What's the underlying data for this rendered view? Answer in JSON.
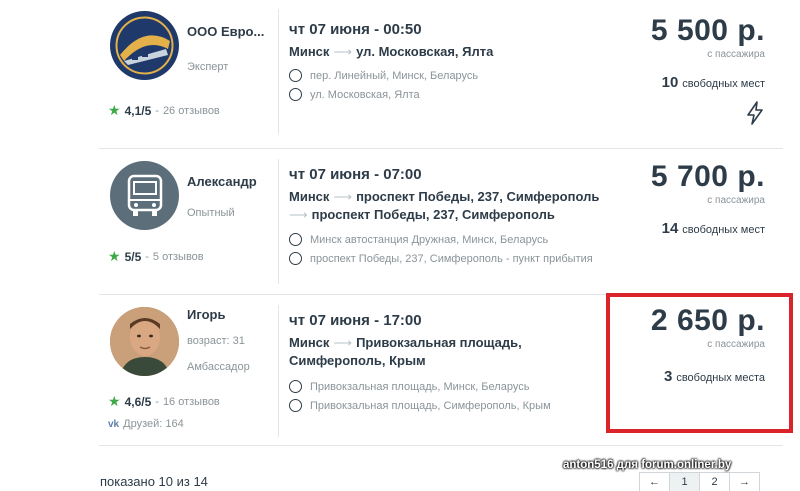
{
  "trips": [
    {
      "driver": "ООО Евро...",
      "status": "Эксперт",
      "rating": "4,1/5",
      "reviews": "26 отзывов",
      "date": "чт 07 июня - 00:50",
      "route_from": "Минск",
      "route_to": "ул. Московская, Ялта",
      "route_to2": "",
      "stops": [
        "пер. Линейный, Минск, Беларусь",
        "ул. Московская, Ялта"
      ],
      "price": "5 500 р.",
      "per": "с пассажира",
      "seats_num": "10",
      "seats_text": "свободных мест",
      "instant_icon": "lightning-icon"
    },
    {
      "driver": "Александр",
      "status": "Опытный",
      "rating": "5/5",
      "reviews": "5 отзывов",
      "date": "чт 07 июня - 07:00",
      "route_from": "Минск",
      "route_to": "проспект Победы, 237, Симферополь",
      "route_to2": "проспект Победы, 237, Симферополь",
      "stops": [
        "Минск автостанция Дружная, Минск, Беларусь",
        "проспект Победы, 237, Симферополь - пункт прибытия"
      ],
      "price": "5 700 р.",
      "per": "с пассажира",
      "seats_num": "14",
      "seats_text": "свободных мест"
    },
    {
      "driver": "Игорь",
      "age": "возраст: 31",
      "status": "Амбассадор",
      "rating": "4,6/5",
      "reviews": "16 отзывов",
      "friends": "Друзей: 164",
      "date": "чт 07 июня - 17:00",
      "route_from": "Минск",
      "route_to": "Привокзальная площадь,",
      "route_to2": "Симферополь, Крым",
      "stops": [
        "Привокзальная площадь, Минск, Беларусь",
        "Привокзальная площадь, Симферополь, Крым"
      ],
      "price": "2 650 р.",
      "per": "с пассажира",
      "seats_num": "3",
      "seats_text": "свободных места"
    }
  ],
  "footer": {
    "count": "показано 10 из 14",
    "watermark": "anton516 для forum.onliner.by",
    "pager": [
      "←",
      "1",
      "2",
      "→"
    ]
  },
  "colors": {
    "accent_green": "#3daa4a",
    "highlight_red": "#d9242b",
    "text_dark": "#2d3c48"
  }
}
